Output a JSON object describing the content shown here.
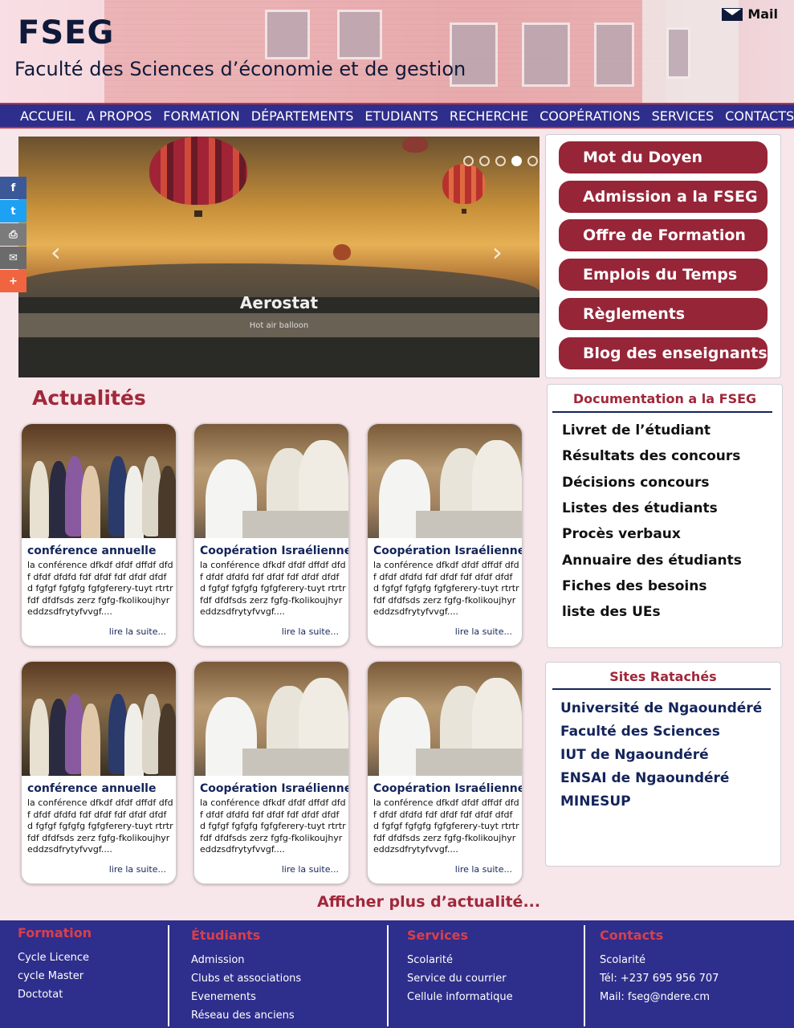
{
  "header": {
    "logo": "FSEG",
    "subtitle": "Faculté des Sciences d’économie et de gestion",
    "mail_label": "Mail"
  },
  "nav": [
    "ACCUEIL",
    "A PROPOS",
    "FORMATION",
    "DÉPARTEMENTS",
    "ETUDIANTS",
    "RECHERCHE",
    "COOPÉRATIONS",
    "SERVICES",
    "CONTACTS"
  ],
  "slider": {
    "caption_title": "Aerostat",
    "caption_sub": "Hot air balloon",
    "prev": "‹",
    "next": "›",
    "dots": 5,
    "active_dot": 4
  },
  "share": [
    {
      "icon": "facebook-icon",
      "glyph": "f",
      "color": "#3b5998"
    },
    {
      "icon": "twitter-icon",
      "glyph": "t",
      "color": "#1da1f2"
    },
    {
      "icon": "print-icon",
      "glyph": "⎙",
      "color": "#7b7b7b"
    },
    {
      "icon": "email-icon",
      "glyph": "✉",
      "color": "#6b6b6b"
    },
    {
      "icon": "plus-icon",
      "glyph": "+",
      "color": "#f0653f"
    }
  ],
  "quick_links": [
    "Mot du Doyen",
    "Admission a la FSEG",
    "Offre de Formation",
    "Emplois du Temps",
    "Règlements",
    "Blog des enseignants"
  ],
  "news": {
    "title": "Actualités",
    "more": "Afficher plus d’actualité...",
    "read_more": "lire la suite...",
    "body": "la conférence dfkdf dfdf dffdf dfdf dfdf dfdfd fdf dfdf fdf dfdf dfdf d fgfgf fgfgfg fgfgferery-tuyt rtrtrfdf dfdfsds zerz fgfg-fkolikoujhyreddzsdfrytyfvvgf....",
    "cards": [
      {
        "title": "conférence annuelle",
        "photo": "group"
      },
      {
        "title": "Coopération Israélienne",
        "photo": "meeting"
      },
      {
        "title": "Coopération Israélienne",
        "photo": "meeting"
      },
      {
        "title": "conférence annuelle",
        "photo": "group"
      },
      {
        "title": "Coopération Israélienne",
        "photo": "meeting"
      },
      {
        "title": "Coopération Israélienne",
        "photo": "meeting"
      }
    ]
  },
  "documentation": {
    "title": "Documentation a la FSEG",
    "items": [
      "Livret de l’étudiant",
      "Résultats des concours",
      "Décisions concours",
      "Listes des étudiants",
      "Procès verbaux",
      "Annuaire des étudiants",
      "Fiches des besoins",
      "liste des UEs"
    ]
  },
  "sites": {
    "title": "Sites Ratachés",
    "items": [
      "Université de Ngaoundéré",
      "Faculté des Sciences",
      "IUT de Ngaoundéré",
      "ENSAI de Ngaoundéré",
      "MINESUP"
    ]
  },
  "footer": [
    {
      "title": "Formation",
      "items": [
        "Cycle Licence",
        "cycle Master",
        "Doctotat"
      ]
    },
    {
      "title": "Étudiants",
      "items": [
        "Admission",
        "Clubs et associations",
        "Evenements",
        "Réseau des anciens"
      ]
    },
    {
      "title": "Services",
      "items": [
        "Scolarité",
        "Service du courrier",
        "Cellule informatique"
      ]
    },
    {
      "title": "Contacts",
      "items": [
        "Scolarité",
        "Tél: +237 695 956 707",
        "Mail: fseg@ndere.cm"
      ]
    }
  ]
}
